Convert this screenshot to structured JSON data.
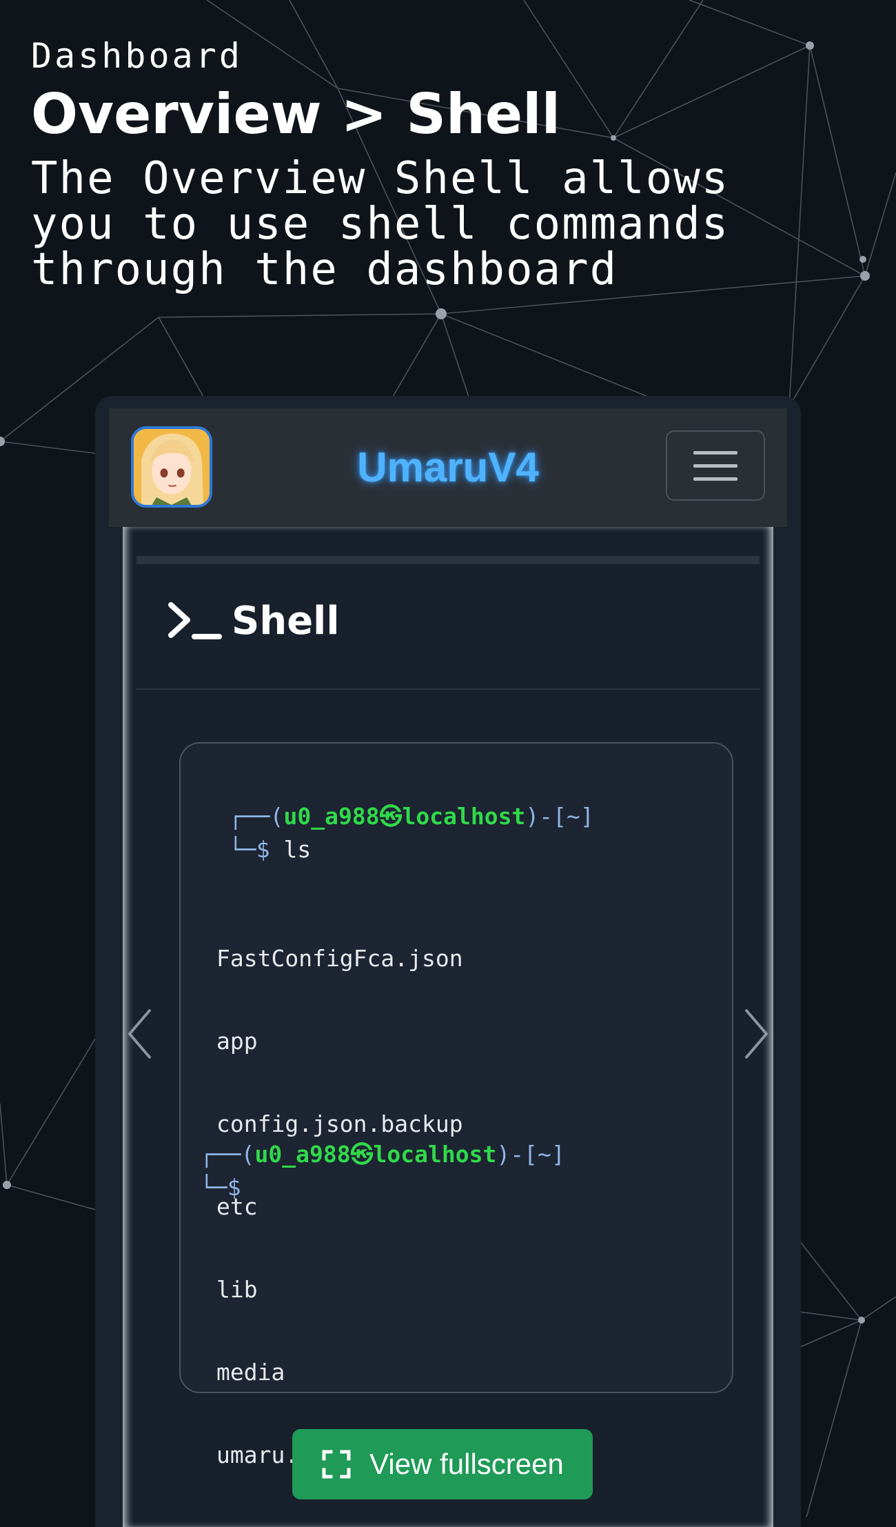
{
  "header": {
    "eyebrow": "Dashboard",
    "title": "Overview > Shell",
    "description": "The Overview Shell allows\nyou to use shell commands\nthrough the dashboard"
  },
  "navbar": {
    "brand": "UmaruV4",
    "avatar_icon": "anime-avatar",
    "menu_icon": "hamburger-menu-icon"
  },
  "shell": {
    "icon": "terminal-icon",
    "title": "Shell",
    "prompt_open": "┌──(",
    "prompt_user": "u0_a988㉿localhost",
    "prompt_close": ")-[~]",
    "prompt_line2": "└─$ ",
    "command": "ls",
    "output": [
      "FastConfigFca.json",
      "app",
      "config.json.backup",
      "etc",
      "lib",
      "media",
      "umaru.js"
    ],
    "prompt2_line2": "└─$"
  },
  "fullscreen": {
    "icon": "fullscreen-icon",
    "label": "View fullscreen"
  },
  "colors": {
    "background": "#0f141b",
    "brand_glow": "#4fb3ff",
    "prompt_user": "#30d94a",
    "prompt_bracket": "#8fb6e6",
    "button": "#1f9a57"
  }
}
